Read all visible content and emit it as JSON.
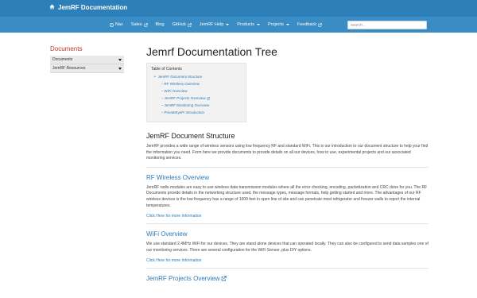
{
  "brand": {
    "title": "JemRF Documentation",
    "icon": "home-icon"
  },
  "nav": {
    "items": [
      {
        "label": "Nav",
        "icon": "compass-icon",
        "caret": false,
        "external": false
      },
      {
        "label": "Sales",
        "caret": false,
        "external": true
      },
      {
        "label": "Blog",
        "caret": false,
        "external": false
      },
      {
        "label": "GitHub",
        "caret": false,
        "external": true
      },
      {
        "label": "JemRF Help",
        "caret": true,
        "external": false
      },
      {
        "label": "Products",
        "caret": true,
        "external": false
      },
      {
        "label": "Projects",
        "caret": true,
        "external": false
      },
      {
        "label": "Feedback",
        "caret": false,
        "external": true
      }
    ],
    "search_placeholder": "search..."
  },
  "sidebar": {
    "title": "Documents",
    "items": [
      {
        "label": "Documents"
      },
      {
        "label": "JemRF Resources"
      }
    ]
  },
  "main": {
    "title": "Jemrf Documentation Tree",
    "toc": {
      "title": "Table of Contents",
      "top": "JemRF Document Structure",
      "items": [
        "RF Wireless Overview",
        "WiFi Overview",
        "JemRF Projects Overview",
        "JemRF Monitoring Overview",
        "PrivateEyePi Introduction"
      ]
    },
    "sections": {
      "structure": {
        "heading": "JemRF Document Structure",
        "text": "JemRF provides a wide range of wireless sensors using low frequency RF and standard WiFi. This is our introduction to our document structure to help your find the information you need. From here we provide documents to provide details on all our devices, how to use, experimental projects and our associated monitoring services."
      },
      "rf": {
        "heading": "RF Wireless Overview",
        "text": "JemRF radio modules are easy to use wireless data transmission modules where all the error checking, encoding, packetization and CRC done for you. The RF Documents provide details in the networking structure used, the message types, message formats, help getting started and more. The advantages of our RF wireless devices is the low frequency has a range of 1000 feet in open line of site and can penetrate most refrigerator and freezer walls to report the internal temperatures.",
        "link": "Click Here for more Information"
      },
      "wifi": {
        "heading": "WiFi Overview",
        "text": "We use standard 2.4MHz WiFi for our devices. They are stand alone devices that can operated locally. They can also be configured to send data samples one of our monitoring services. There are several configuration for the WiFi Sensor, plus DIY options.",
        "link": "Click Here for more Information"
      },
      "projects": {
        "heading": "JemRF Projects Overview"
      }
    }
  }
}
